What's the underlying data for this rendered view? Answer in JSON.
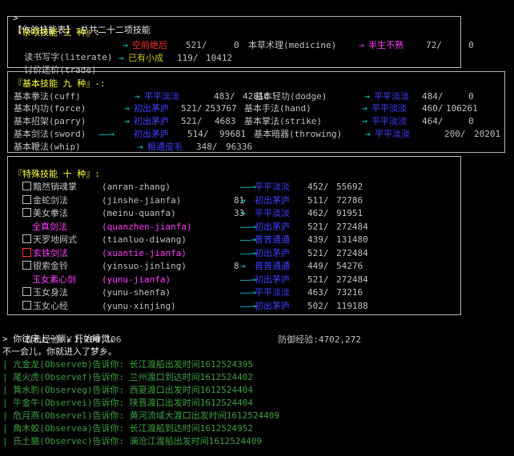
{
  "header": {
    "prompt": ">",
    "title": "【你的技能表】:",
    "summary": "总共二十二项技能"
  },
  "misc": {
    "heading": "『杂项技能 三 种』:",
    "rows": [
      {
        "name": "读书写字(literate)",
        "level": "空前绝后",
        "num": "521/",
        "exp": "0",
        "name2": "本草术理(medicine)",
        "level2": "半生不熟",
        "num2": "72/",
        "exp2": "0"
      },
      {
        "name": "讨价还价(trade)",
        "level": "已有小成",
        "num": "119/",
        "exp": "10412"
      }
    ]
  },
  "basic": {
    "heading": "『基本技能 九 种』-:",
    "rows": [
      {
        "name": "基本拳法(cuff)",
        "level": "平平淡淡",
        "num": "483/",
        "exp": "42816",
        "name2": "基本轻功(dodge)",
        "level2": "平平淡淡",
        "num2": "484/",
        "exp2": "0"
      },
      {
        "name": "基本内功(force)",
        "level": "初出茅庐",
        "num": "521/",
        "exp": "253767",
        "name2": "基本手法(hand)",
        "level2": "平平淡淡",
        "num2": "460/",
        "exp2": "106261"
      },
      {
        "name": "基本招架(parry)",
        "level": "初出茅庐",
        "num": "521/",
        "exp": "4683",
        "name2": "基本掌法(strike)",
        "level2": "平平淡淡",
        "num2": "464/",
        "exp2": "0"
      },
      {
        "name": "基本剑法(sword)",
        "level": "初出茅庐",
        "num": "514/",
        "exp": "99681",
        "name2": "基本暗器(throwing)",
        "level2": "平平淡淡",
        "num2": "200/",
        "exp2": "20201"
      },
      {
        "name": "基本鞭法(whip)",
        "level": "粗通皮毛",
        "num": "348/",
        "exp": "96336"
      }
    ]
  },
  "special": {
    "heading": "『特殊技能 十 种』:",
    "rows": [
      {
        "name": "黯然销魂掌",
        "id": "(anran-zhang)",
        "pre": "",
        "level": "平平淡淡",
        "num": "452/",
        "exp": "55692",
        "color": "gry",
        "box": true
      },
      {
        "name": "金蛇剑法",
        "id": "(jinshe-jianfa)",
        "pre": "81",
        "level": "初出茅庐",
        "num": "511/",
        "exp": "72786",
        "color": "gry",
        "box": true
      },
      {
        "name": "美女拳法",
        "id": "(meinu-quanfa)",
        "pre": "33",
        "level": "平平淡淡",
        "num": "462/",
        "exp": "91951",
        "color": "gry",
        "box": true
      },
      {
        "name": "全真剑法",
        "id": "(quanzhen-jianfa)",
        "pre": "",
        "level": "初出茅庐",
        "num": "521/",
        "exp": "272484",
        "color": "mag",
        "box": false
      },
      {
        "name": "天罗地网式",
        "id": "(tianluo-diwang)",
        "pre": "",
        "level": "普普通通",
        "num": "439/",
        "exp": "131480",
        "color": "gry",
        "box": true
      },
      {
        "name": "玄铁剑法",
        "id": "(xuantie-jianfa)",
        "pre": "",
        "level": "初出茅庐",
        "num": "521/",
        "exp": "272484",
        "color": "mag",
        "box": true
      },
      {
        "name": "银索金铃",
        "id": "(yinsuo-jinling)",
        "pre": "8",
        "level": "普普通通",
        "num": "449/",
        "exp": "54276",
        "color": "gry",
        "box": true
      },
      {
        "name": "玉女素心剑",
        "id": "(yunu-jianfa)",
        "pre": "",
        "level": "初出茅庐",
        "num": "521/",
        "exp": "272484",
        "color": "mag",
        "box": false
      },
      {
        "name": "玉女身法",
        "id": "(yunu-shenfa)",
        "pre": "",
        "level": "平平淡淡",
        "num": "463/",
        "exp": "73216",
        "color": "gry",
        "box": true
      },
      {
        "name": "玉女心经",
        "id": "(yunu-xinjing)",
        "pre": "",
        "level": "初出茅庐",
        "num": "502/",
        "exp": "119188",
        "color": "gry",
        "box": true
      }
    ]
  },
  "stats": {
    "attack_label": "攻击经验:",
    "attack": "￥1,700,106",
    "defense_label": "防御经验:",
    "defense": "4702,272"
  },
  "log": [
    {
      "text": "> 你往床上一躺，开始睡觉。",
      "color": "wht"
    },
    {
      "text": "不一会儿，你就进入了梦乡。",
      "color": "wht"
    },
    {
      "text": "| 亢金龙(Observeb)告诉你: 长江渡船出发时间1612524395",
      "color": "dgrn"
    },
    {
      "text": "| 尾火虎(Observef)告诉你: 兰州渡口到达时间1612524402",
      "color": "dgrn"
    },
    {
      "text": "| 箕水豹(Observeg)告诉你: 西夏渡口出发时间1612524404",
      "color": "dgrn"
    },
    {
      "text": "| 牛金牛(Observei)告诉你: 陕晋渡口出发时间1612524404",
      "color": "dgrn"
    },
    {
      "text": "| 危月燕(Observel)告诉你: 黄河流域大渡口出发时间1612524409",
      "color": "dgrn"
    },
    {
      "text": "| 角木蛟(Observea)告诉你: 长江渡船到达时间1612524952",
      "color": "dgrn"
    },
    {
      "text": "| 氐土貉(Observec)告诉你: 澜沧江渡船出发时间1612524409",
      "color": "dgrn"
    }
  ]
}
